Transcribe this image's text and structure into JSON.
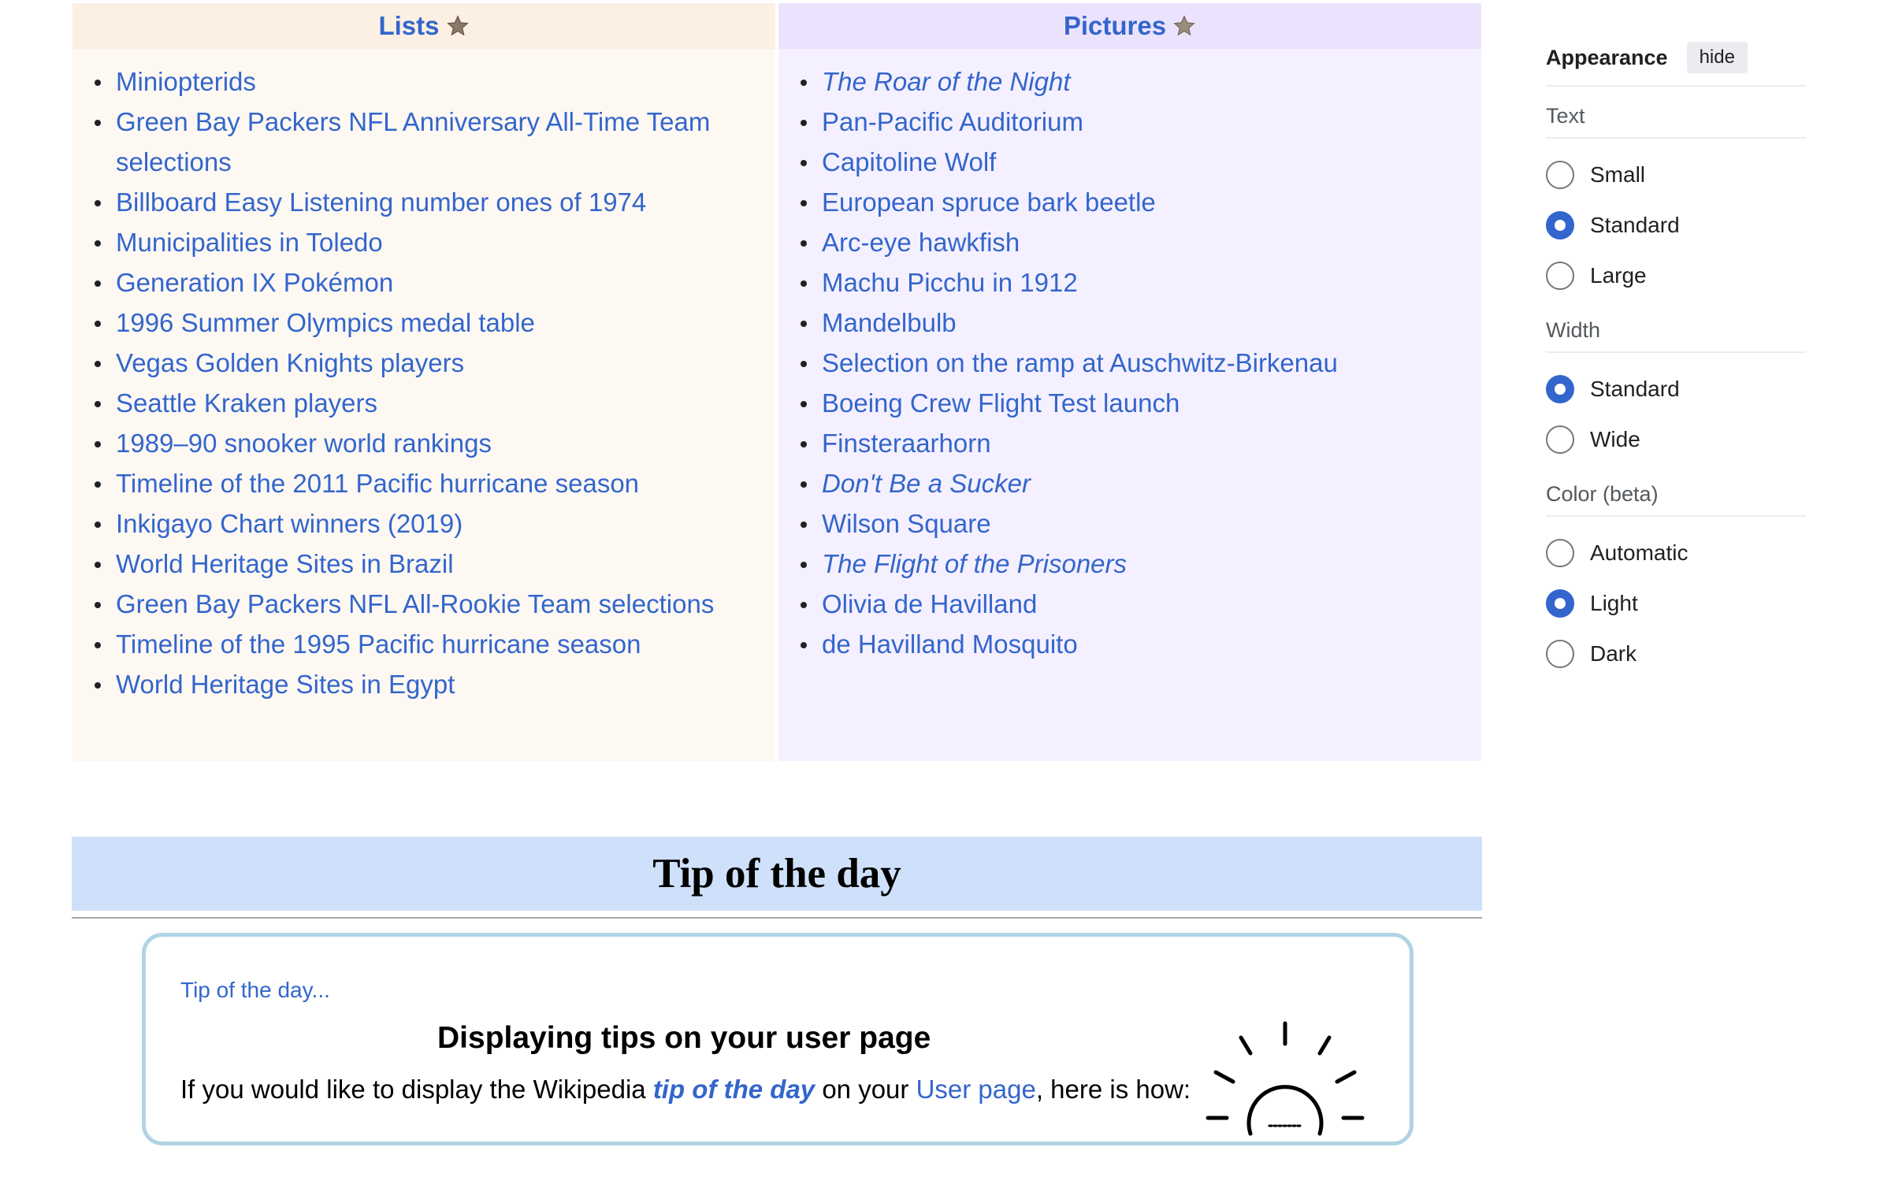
{
  "featured": {
    "lists": {
      "heading": "Lists",
      "items": [
        "Miniopterids",
        "Green Bay Packers NFL Anniversary All-Time Team selections",
        "Billboard Easy Listening number ones of 1974",
        "Municipalities in Toledo",
        "Generation IX Pokémon",
        "1996 Summer Olympics medal table",
        "Vegas Golden Knights players",
        "Seattle Kraken players",
        "1989–90 snooker world rankings",
        "Timeline of the 2011 Pacific hurricane season",
        "Inkigayo Chart winners (2019)",
        "World Heritage Sites in Brazil",
        "Green Bay Packers NFL All-Rookie Team selections",
        "Timeline of the 1995 Pacific hurricane season",
        "World Heritage Sites in Egypt"
      ]
    },
    "pictures": {
      "heading": "Pictures",
      "items": [
        {
          "text": "The Roar of the Night",
          "italic": true
        },
        {
          "text": "Pan-Pacific Auditorium",
          "italic": false
        },
        {
          "text": "Capitoline Wolf",
          "italic": false
        },
        {
          "text": "European spruce bark beetle",
          "italic": false
        },
        {
          "text": "Arc-eye hawkfish",
          "italic": false
        },
        {
          "text": "Machu Picchu in 1912",
          "italic": false
        },
        {
          "text": "Mandelbulb",
          "italic": false
        },
        {
          "text": "Selection on the ramp at Auschwitz-Birkenau",
          "italic": false
        },
        {
          "text": "Boeing Crew Flight Test launch",
          "italic": false
        },
        {
          "text": "Finsteraarhorn",
          "italic": false
        },
        {
          "text": "Don't Be a Sucker",
          "italic": true
        },
        {
          "text": "Wilson Square",
          "italic": false
        },
        {
          "text": "The Flight of the Prisoners",
          "italic": true
        },
        {
          "text": "Olivia de Havilland",
          "italic": false
        },
        {
          "text": "de Havilland Mosquito",
          "italic": false
        }
      ]
    }
  },
  "tip": {
    "banner_title": "Tip of the day",
    "small_link": "Tip of the day...",
    "title": "Displaying tips on your user page",
    "body_prefix": "If you would like to display the Wikipedia ",
    "body_link": "tip of the day",
    "body_mid": " on your ",
    "body_link2": "User page",
    "body_suffix": ", here is how:"
  },
  "appearance": {
    "title": "Appearance",
    "hide_label": "hide",
    "sections": [
      {
        "label": "Text",
        "options": [
          {
            "label": "Small",
            "checked": false
          },
          {
            "label": "Standard",
            "checked": true
          },
          {
            "label": "Large",
            "checked": false
          }
        ]
      },
      {
        "label": "Width",
        "options": [
          {
            "label": "Standard",
            "checked": true
          },
          {
            "label": "Wide",
            "checked": false
          }
        ]
      },
      {
        "label": "Color (beta)",
        "options": [
          {
            "label": "Automatic",
            "checked": false
          },
          {
            "label": "Light",
            "checked": true
          },
          {
            "label": "Dark",
            "checked": false
          }
        ]
      }
    ]
  },
  "colors": {
    "link": "#3366cc",
    "lists_bg": "#fef8f3",
    "pictures_bg": "#f5f0ff",
    "tip_banner_bg": "#cfe0fb",
    "radio_checked": "#3366cc"
  }
}
